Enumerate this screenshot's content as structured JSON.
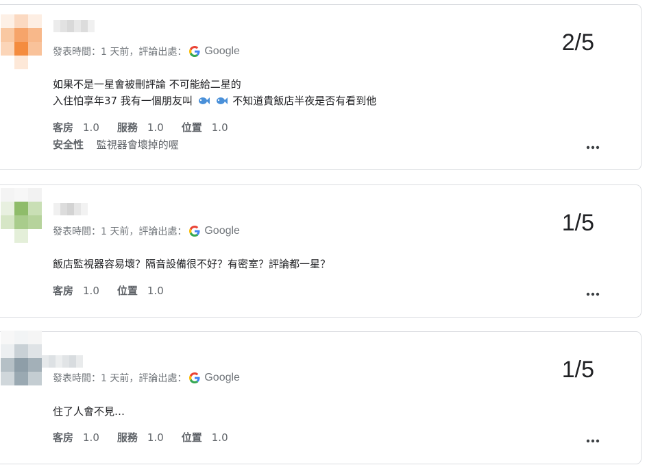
{
  "reviews": [
    {
      "meta_prefix": "發表時間：1 天前，評論出處：",
      "source": "Google",
      "score": "2/5",
      "text_line1": "如果不是一星會被刪評論 不可能給二星的",
      "text_line2_a": "入住怕享年37 我有一個朋友叫",
      "text_line2_b": "不知道貴飯店半夜是否有看到他",
      "emoji": "fish-icon",
      "ratings": [
        {
          "label": "客房",
          "value": "1.0"
        },
        {
          "label": "服務",
          "value": "1.0"
        },
        {
          "label": "位置",
          "value": "1.0"
        }
      ],
      "extra_label": "安全性",
      "extra_value": "監視器會壞掉的喔"
    },
    {
      "meta_prefix": "發表時間：1 天前，評論出處：",
      "source": "Google",
      "score": "1/5",
      "text_line1": "飯店監視器容易壞？隔音設備很不好？有密室？評論都一星？",
      "ratings": [
        {
          "label": "客房",
          "value": "1.0"
        },
        {
          "label": "位置",
          "value": "1.0"
        }
      ]
    },
    {
      "meta_prefix": "發表時間：1 天前，評論出處：",
      "source": "Google",
      "score": "1/5",
      "text_line1": "住了人會不見…",
      "ratings": [
        {
          "label": "客房",
          "value": "1.0"
        },
        {
          "label": "服務",
          "value": "1.0"
        },
        {
          "label": "位置",
          "value": "1.0"
        }
      ]
    }
  ],
  "colors": {
    "avatar1": [
      "#fbe0cc",
      "#f6a46a",
      "#f48c3f",
      "#f9c8a2"
    ],
    "avatar2": [
      "#d6e6c6",
      "#8fbc6a",
      "#a9cc8c",
      "#e4efd9"
    ],
    "avatar3": [
      "#dfe3e6",
      "#8e9ea8",
      "#b5c0c6",
      "#eceff1"
    ]
  }
}
